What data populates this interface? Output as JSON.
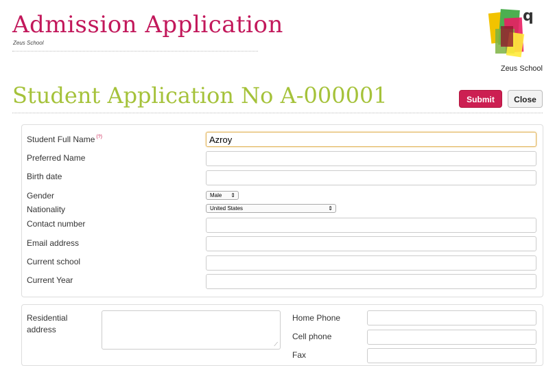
{
  "header": {
    "title": "Admission Application",
    "school_small": "Zeus School",
    "logo_caption": "Zeus School"
  },
  "application": {
    "title": "Student Application No A-000001",
    "submit_label": "Submit",
    "close_label": "Close"
  },
  "student": {
    "full_name_label": "Student Full Name",
    "required_marker": "(?)",
    "full_name_value": "Azroy",
    "preferred_name_label": "Preferred Name",
    "birth_date_label": "Birth date",
    "gender_label": "Gender",
    "gender_value": "Male",
    "nationality_label": "Nationality",
    "nationality_value": "United States",
    "contact_label": "Contact number",
    "email_label": "Email address",
    "school_label": "Current school",
    "year_label": "Current Year"
  },
  "contact": {
    "residential_label_1": "Residential",
    "residential_label_2": "address",
    "home_phone_label": "Home Phone",
    "cell_phone_label": "Cell phone",
    "fax_label": "Fax"
  },
  "colors": {
    "title": "#c2185b",
    "app_title": "#a5c23a",
    "submit": "#cc1f52"
  }
}
